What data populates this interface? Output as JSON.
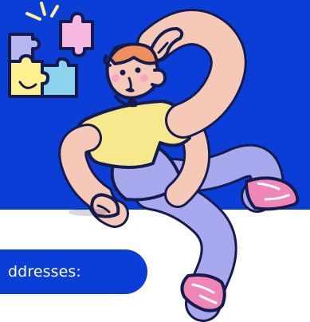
{
  "banner": {
    "caption_fragment": "ddresses:"
  },
  "colors": {
    "primary_blue": "#0a3ed6",
    "white": "#ffffff",
    "puzzle_pink": "#f6b8e0",
    "puzzle_lavender": "#b7b5ef",
    "puzzle_yellow": "#fff092",
    "puzzle_blue": "#8dd3ef",
    "shirt_yellow": "#f7e78d",
    "pants_lavender": "#a8a8ef",
    "skin_peach": "#f5c8b7",
    "hair_orange": "#ef8f5d",
    "shoe_pink": "#ef86b8"
  },
  "icons": {
    "sparkles": "sparkles-icon",
    "puzzle": "puzzle-pieces-illustration",
    "character": "happy-thinking-character-illustration"
  }
}
